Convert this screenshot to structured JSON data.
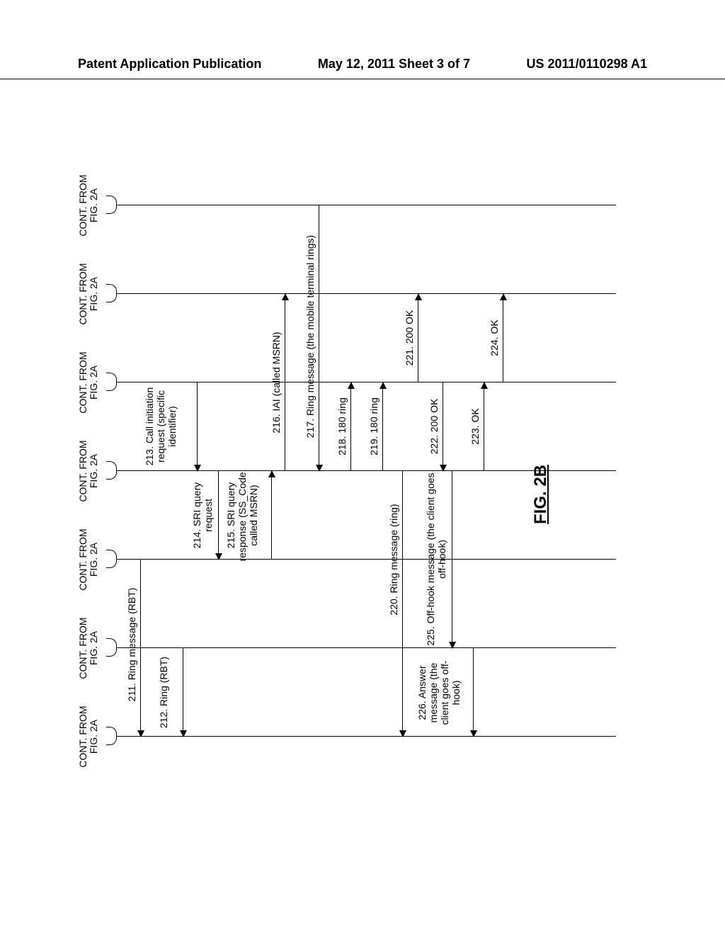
{
  "header": {
    "left": "Patent Application Publication",
    "center": "May 12, 2011  Sheet 3 of 7",
    "right": "US 2011/0110298 A1"
  },
  "lifelines": [
    {
      "id": "l1",
      "top": "CONT. FROM FIG. 2A"
    },
    {
      "id": "l2",
      "top": "CONT. FROM FIG. 2A"
    },
    {
      "id": "l3",
      "top": "CONT. FROM FIG. 2A"
    },
    {
      "id": "l4",
      "top": "CONT. FROM FIG. 2A"
    },
    {
      "id": "l5",
      "top": "CONT. FROM FIG. 2A"
    },
    {
      "id": "l6",
      "top": "CONT. FROM FIG. 2A"
    },
    {
      "id": "l7",
      "top": "CONT. FROM FIG. 2A"
    }
  ],
  "messages": {
    "m211": "211. Ring message (RBT)",
    "m212": "212. Ring (RBT)",
    "m213": "213. Call initiation request (specific identifier)",
    "m214": "214. SRI query request",
    "m215": "215. SRI query response (SS_Code, called MSRN)",
    "m216": "216. IAI (called MSRN)",
    "m217": "217. Ring message (the mobile terminal rings)",
    "m218": "218. 180 ring",
    "m219": "219. 180 ring",
    "m220": "220. Ring message (ring)",
    "m221": "221. 200 OK",
    "m222": "222. 200 OK",
    "m223": "223. OK",
    "m224": "224. OK",
    "m225": "225. Off-hook message (the client goes off-hook)",
    "m226": "226. Answer message (the client goes off-hook)"
  },
  "figure_label": "FIG. 2B"
}
